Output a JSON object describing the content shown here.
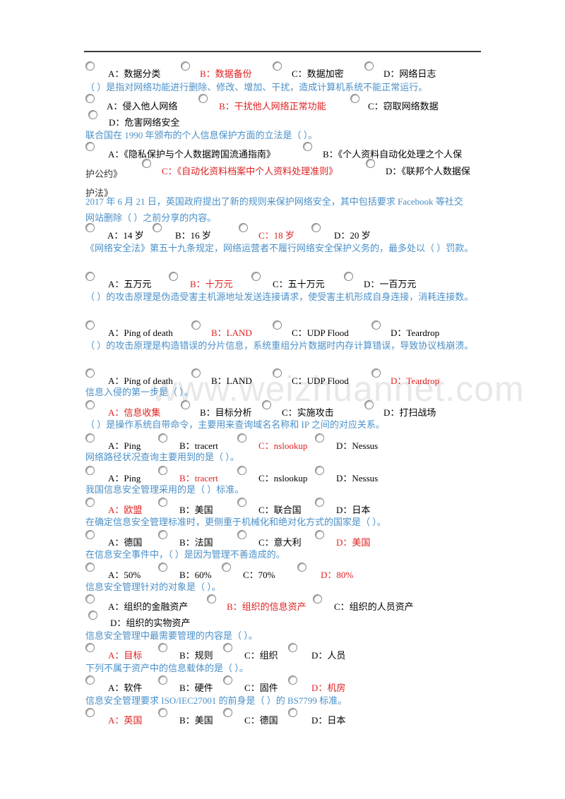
{
  "watermark": "www.weizhuannet.com",
  "colors": {
    "question": "#4a90c8",
    "option": "#333333",
    "correct": "#e02020"
  },
  "questions": [
    {
      "text": "",
      "options": [
        {
          "label": "A：数据分类",
          "correct": false
        },
        {
          "label": "B：数据备份",
          "correct": true
        },
        {
          "label": "C：数据加密",
          "correct": false
        },
        {
          "label": "D：网络日志",
          "correct": false
        }
      ]
    },
    {
      "text": "（ ）是指对网络功能进行删除、修改、增加、干扰，造成计算机系统不能正常运行。",
      "options": [
        {
          "label": "A：侵入他人网络",
          "correct": false
        },
        {
          "label": "B：干扰他人网络正常功能",
          "correct": true
        },
        {
          "label": "C：窃取网络数据",
          "correct": false
        },
        {
          "label": "D：危害网络安全",
          "correct": false
        }
      ]
    },
    {
      "text": "联合国在 1990 年颁布的个人信息保护方面的立法是（ ）。",
      "options": [
        {
          "label": "A：《隐私保护与个人数据跨国流通指南》",
          "correct": false
        },
        {
          "label": "B：《个人资料自动化处理之个人保护公约》",
          "correct": false
        },
        {
          "label": "C：《自动化资料档案中个人资料处理准则》",
          "correct": true
        },
        {
          "label": "D：《联邦个人数据保护法》",
          "correct": false
        }
      ],
      "wrapped_lines": {
        "line1_b": "B：《个人资料自动化处理之个人保",
        "line2_b_end": "护公约》",
        "line2_d": "D：《联邦个人数据保",
        "line3_d_end": "护法》"
      }
    },
    {
      "text": "2017 年 6 月 21 日，英国政府提出了新的规则来保护网络安全，其中包括要求 Facebook 等社交网站删除（ ）之前分享的内容。",
      "text_lines": [
        "2017 年 6 月 21 日，英国政府提出了新的规则来保护网络安全，其中包括要求 Facebook 等社交",
        "网站删除（ ）之前分享的内容。"
      ],
      "options": [
        {
          "label": "A：14 岁",
          "correct": false
        },
        {
          "label": "B：16 岁",
          "correct": false
        },
        {
          "label": "C：18 岁",
          "correct": true
        },
        {
          "label": "D：20 岁",
          "correct": false
        }
      ]
    },
    {
      "text": "《网络安全法》第五十九条规定，网络运营者不履行网络安全保护义务的，最多处以（ ）罚款。",
      "options": [
        {
          "label": "A：五万元",
          "correct": false
        },
        {
          "label": "B：十万元",
          "correct": true
        },
        {
          "label": "C：五十万元",
          "correct": false
        },
        {
          "label": "D：一百万元",
          "correct": false
        }
      ]
    },
    {
      "text": "（ ）的攻击原理是伪造受害主机源地址发送连接请求，使受害主机形成自身连接，消耗连接数。",
      "options": [
        {
          "label": "A：Ping of death",
          "correct": false
        },
        {
          "label": "B：LAND",
          "correct": true
        },
        {
          "label": "C：UDP Flood",
          "correct": false
        },
        {
          "label": "D：Teardrop",
          "correct": false
        }
      ]
    },
    {
      "text": "（ ）的攻击原理是构造错误的分片信息，系统重组分片数据时内存计算错误，导致协议栈崩溃。",
      "options": [
        {
          "label": "A：Ping of death",
          "correct": false
        },
        {
          "label": "B：LAND",
          "correct": false
        },
        {
          "label": "C：UDP Flood",
          "correct": false
        },
        {
          "label": "D：Teardrop",
          "correct": true
        }
      ]
    },
    {
      "text": "信息入侵的第一步是（ ）。",
      "options": [
        {
          "label": "A：信息收集",
          "correct": true
        },
        {
          "label": "B：目标分析",
          "correct": false
        },
        {
          "label": "C：实施攻击",
          "correct": false
        },
        {
          "label": "D：打扫战场",
          "correct": false
        }
      ]
    },
    {
      "text": "（ ）是操作系统自带命令，主要用来查询域名名称和 IP 之间的对应关系。",
      "options": [
        {
          "label": "A：Ping",
          "correct": false
        },
        {
          "label": "B：tracert",
          "correct": false
        },
        {
          "label": "C：nslookup",
          "correct": true
        },
        {
          "label": "D：Nessus",
          "correct": false
        }
      ]
    },
    {
      "text": "网络路径状况查询主要用到的是（ ）。",
      "options": [
        {
          "label": "A：Ping",
          "correct": false
        },
        {
          "label": "B：tracert",
          "correct": true
        },
        {
          "label": "C：nslookup",
          "correct": false
        },
        {
          "label": "D：Nessus",
          "correct": false
        }
      ]
    },
    {
      "text": "我国信息安全管理采用的是（ ）标准。",
      "options": [
        {
          "label": "A：欧盟",
          "correct": true
        },
        {
          "label": "B：美国",
          "correct": false
        },
        {
          "label": "C：联合国",
          "correct": false
        },
        {
          "label": "D：日本",
          "correct": false
        }
      ]
    },
    {
      "text": "在确定信息安全管理标准时，更侧重于机械化和绝对化方式的国家是（ ）。",
      "options": [
        {
          "label": "A：德国",
          "correct": false
        },
        {
          "label": "B：法国",
          "correct": false
        },
        {
          "label": "C：意大利",
          "correct": false
        },
        {
          "label": "D：美国",
          "correct": true
        }
      ]
    },
    {
      "text": "在信息安全事件中，（ ）是因为管理不善造成的。",
      "options": [
        {
          "label": "A：50%",
          "correct": false
        },
        {
          "label": "B：60%",
          "correct": false
        },
        {
          "label": "C：70%",
          "correct": false
        },
        {
          "label": "D：80%",
          "correct": true
        }
      ]
    },
    {
      "text": "信息安全管理针对的对象是（ ）。",
      "options": [
        {
          "label": "A：组织的金融资产",
          "correct": false
        },
        {
          "label": "B：组织的信息资产",
          "correct": true
        },
        {
          "label": "C：组织的人员资产",
          "correct": false
        },
        {
          "label": "D：组织的实物资产",
          "correct": false
        }
      ]
    },
    {
      "text": "信息安全管理中最需要管理的内容是（ ）。",
      "options": [
        {
          "label": "A：目标",
          "correct": true
        },
        {
          "label": "B：规则",
          "correct": false
        },
        {
          "label": "C：组织",
          "correct": false
        },
        {
          "label": "D：人员",
          "correct": false
        }
      ]
    },
    {
      "text": "下列不属于资产中的信息载体的是（ ）。",
      "options": [
        {
          "label": "A：软件",
          "correct": false
        },
        {
          "label": "B：硬件",
          "correct": false
        },
        {
          "label": "C：固件",
          "correct": false
        },
        {
          "label": "D：机房",
          "correct": true
        }
      ]
    },
    {
      "text": "信息安全管理要求 ISO/IEC27001 的前身是（ ）的 BS7799 标准。",
      "options": [
        {
          "label": "A：英国",
          "correct": true
        },
        {
          "label": "B：美国",
          "correct": false
        },
        {
          "label": "C：德国",
          "correct": false
        },
        {
          "label": "D：日本",
          "correct": false
        }
      ]
    }
  ]
}
